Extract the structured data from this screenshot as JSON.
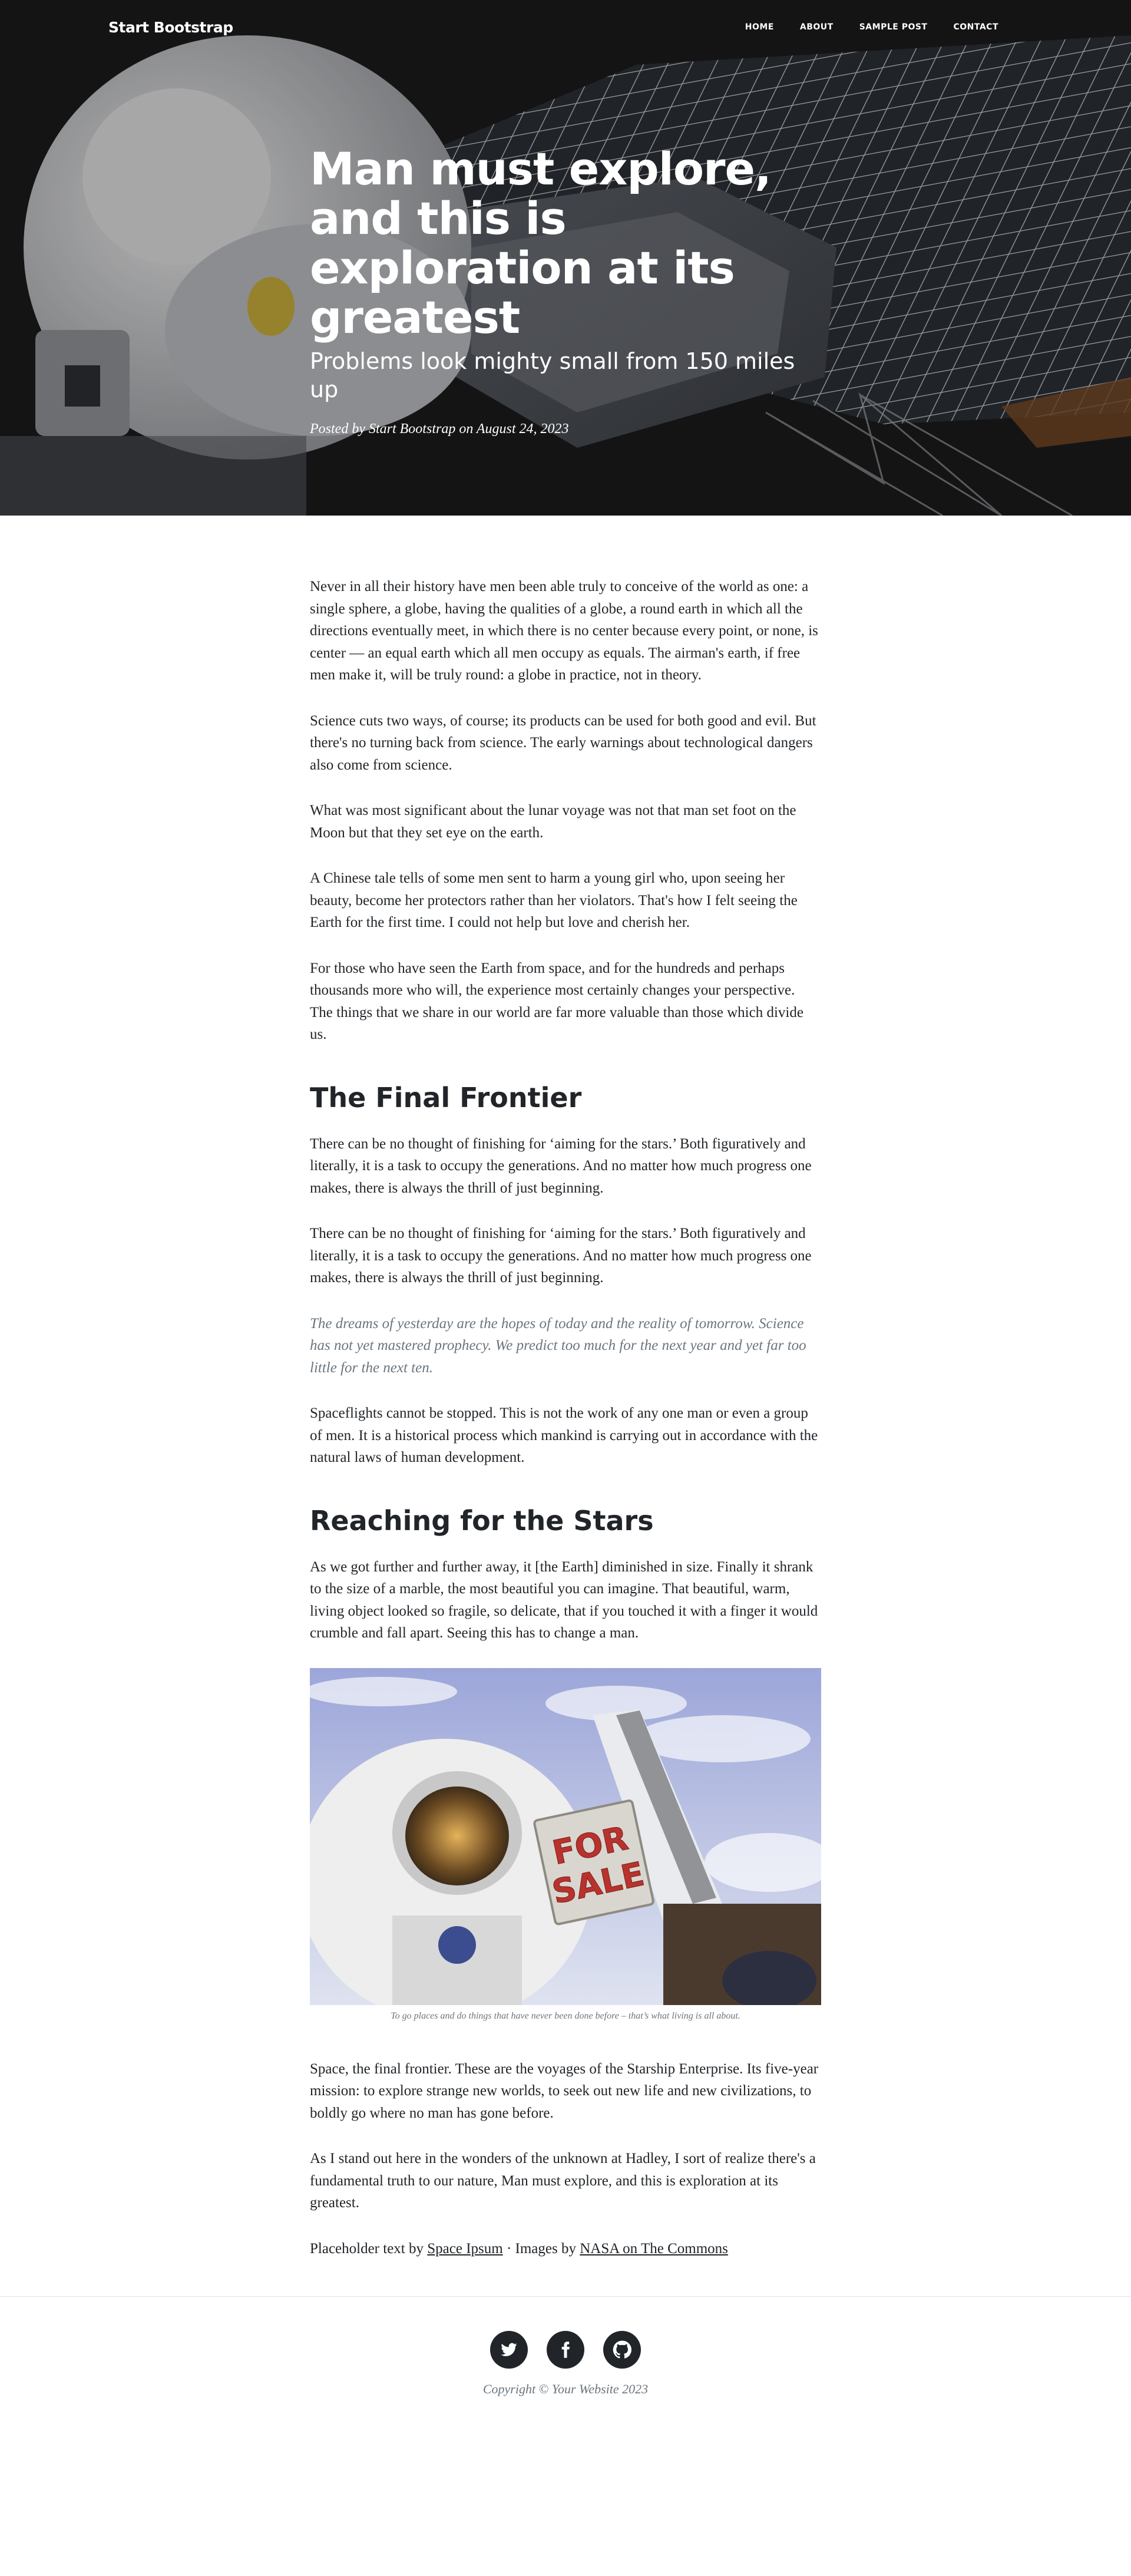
{
  "nav": {
    "brand": "Start Bootstrap",
    "links": [
      "Home",
      "About",
      "Sample Post",
      "Contact"
    ]
  },
  "hero": {
    "title": "Man must explore, and this is exploration at its greatest",
    "subtitle": "Problems look mighty small from 150 miles up",
    "meta": "Posted by Start Bootstrap on August 24, 2023"
  },
  "article": {
    "paragraphs_intro": [
      "Never in all their history have men been able truly to conceive of the world as one: a single sphere, a globe, having the qualities of a globe, a round earth in which all the directions eventually meet, in which there is no center because every point, or none, is center — an equal earth which all men occupy as equals. The airman's earth, if free men make it, will be truly round: a globe in practice, not in theory.",
      "Science cuts two ways, of course; its products can be used for both good and evil. But there's no turning back from science. The early warnings about technological dangers also come from science.",
      "What was most significant about the lunar voyage was not that man set foot on the Moon but that they set eye on the earth.",
      "A Chinese tale tells of some men sent to harm a young girl who, upon seeing her beauty, become her protectors rather than her violators. That's how I felt seeing the Earth for the first time. I could not help but love and cherish her.",
      "For those who have seen the Earth from space, and for the hundreds and perhaps thousands more who will, the experience most certainly changes your perspective. The things that we share in our world are far more valuable than those which divide us."
    ],
    "heading_1": "The Final Frontier",
    "paragraphs_frontier": [
      "There can be no thought of finishing for ‘aiming for the stars.’ Both figuratively and literally, it is a task to occupy the generations. And no matter how much progress one makes, there is always the thrill of just beginning.",
      "There can be no thought of finishing for ‘aiming for the stars.’ Both figuratively and literally, it is a task to occupy the generations. And no matter how much progress one makes, there is always the thrill of just beginning."
    ],
    "quote": "The dreams of yesterday are the hopes of today and the reality of tomorrow. Science has not yet mastered prophecy. We predict too much for the next year and yet far too little for the next ten.",
    "paragraph_spaceflights": "Spaceflights cannot be stopped. This is not the work of any one man or even a group of men. It is a historical process which mankind is carrying out in accordance with the natural laws of human development.",
    "heading_2": "Reaching for the Stars",
    "paragraph_reaching": "As we got further and further away, it [the Earth] diminished in size. Finally it shrank to the size of a marble, the most beautiful you can imagine. That beautiful, warm, living object looked so fragile, so delicate, that if you touched it with a finger it would crumble and fall apart. Seeing this has to change a man.",
    "image_sign": "FOR SALE",
    "image_sign_line1": "FOR",
    "image_sign_line2": "SALE",
    "caption": "To go places and do things that have never been done before – that’s what living is all about.",
    "paragraph_enterprise": "Space, the final frontier. These are the voyages of the Starship Enterprise. Its five-year mission: to explore strange new worlds, to seek out new life and new civilizations, to boldly go where no man has gone before.",
    "paragraph_hadley": "As I stand out here in the wonders of the unknown at Hadley, I sort of realize there's a fundamental truth to our nature, Man must explore, and this is exploration at its greatest.",
    "credits": {
      "prefix": "Placeholder text by ",
      "link1": "Space Ipsum",
      "middle": " · Images by ",
      "link2": "NASA on The Commons"
    }
  },
  "footer": {
    "social": [
      "twitter-icon",
      "facebook-icon",
      "github-icon"
    ],
    "copyright": "Copyright © Your Website 2023"
  }
}
